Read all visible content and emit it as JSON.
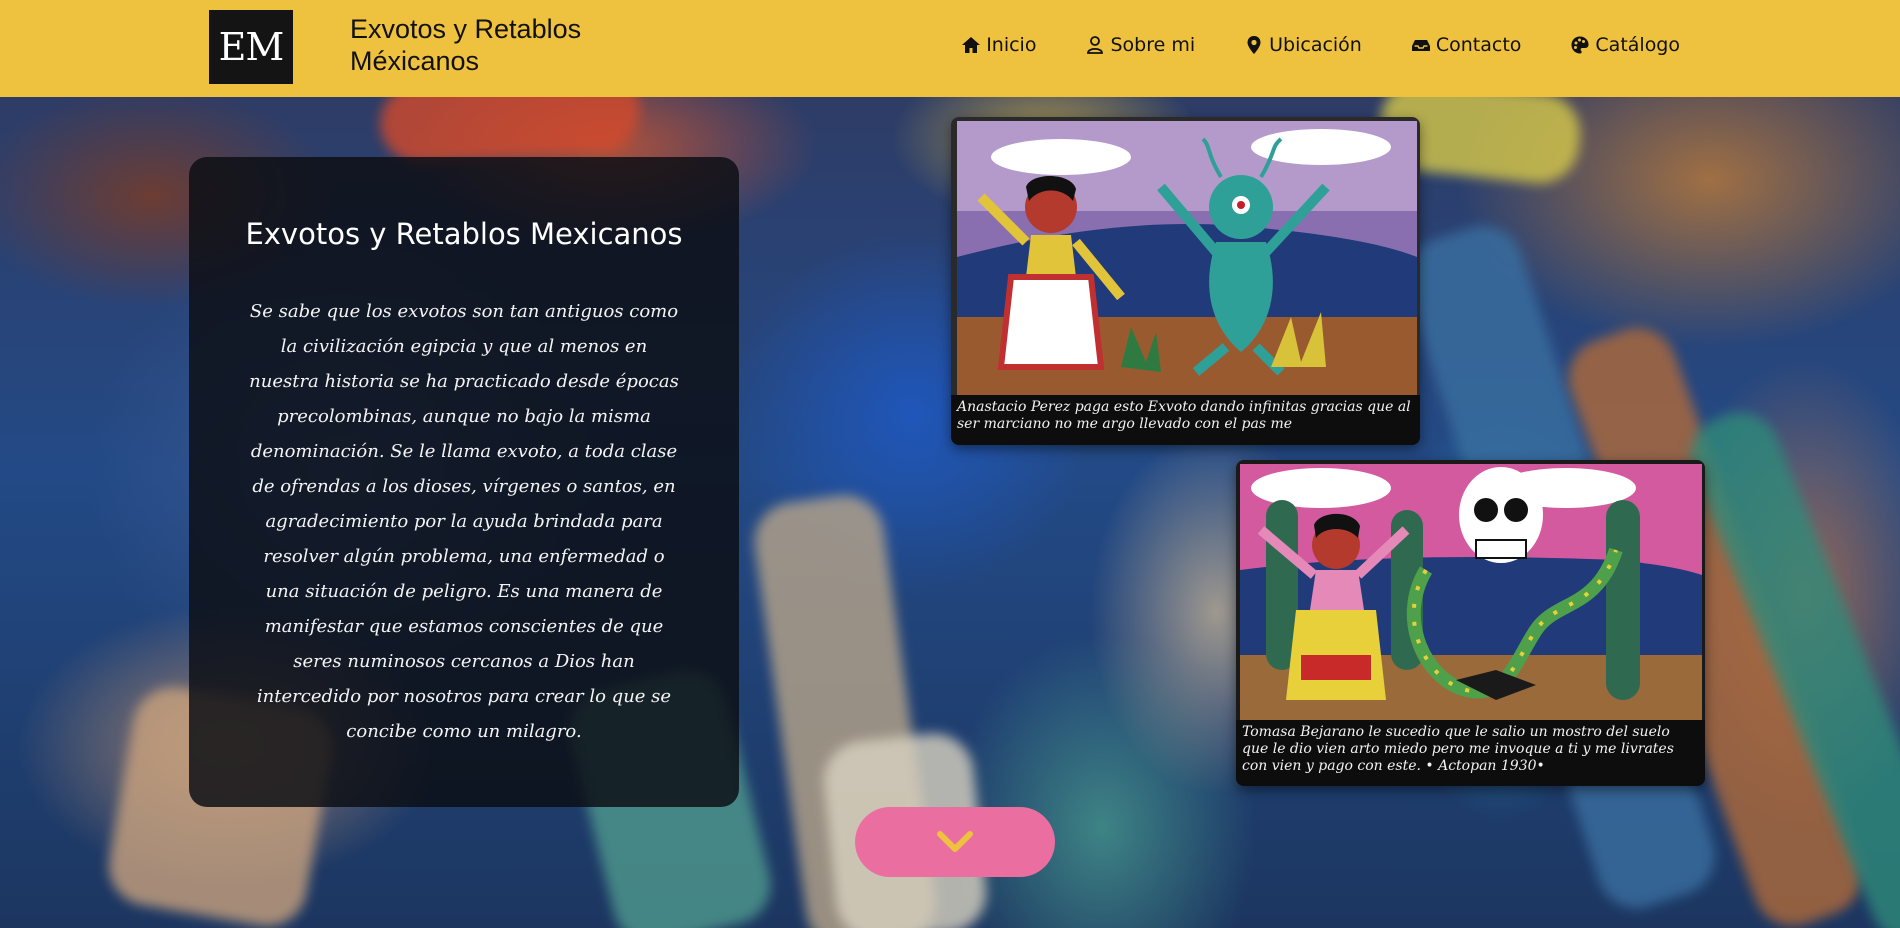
{
  "header": {
    "logo_text": "EM",
    "brand_line1": "Exvotos y Retablos",
    "brand_line2": "Méxicanos",
    "nav": [
      {
        "label": "Inicio",
        "icon": "home-icon"
      },
      {
        "label": "Sobre mi",
        "icon": "user-icon"
      },
      {
        "label": "Ubicación",
        "icon": "map-pin-icon"
      },
      {
        "label": "Contacto",
        "icon": "inbox-icon"
      },
      {
        "label": "Catálogo",
        "icon": "palette-icon"
      }
    ]
  },
  "card": {
    "title": "Exvotos y Retablos Mexicanos",
    "body": "Se sabe que los exvotos son tan antiguos como la civilización egipcia y que al menos en nuestra historia se ha practicado desde épocas precolombinas, aunque no bajo la misma denominación. Se le llama exvoto, a toda clase de ofrendas a los dioses, vírgenes o santos, en agradecimiento por la ayuda brindada para resolver algún problema, una enfermedad o una situación de peligro. Es una manera de manifestar que estamos conscientes de que seres numinosos cercanos a Dios han intercedido por nosotros para crear lo que se concibe como un milagro."
  },
  "paintings": [
    {
      "caption": "Anastacio Perez paga esto Exvoto dando infinitas gracias que al ser marciano no me argo llevado con el pas me"
    },
    {
      "caption": "Tomasa Bejarano le sucedio que le salio un mostro del suelo que le dio vien arto miedo pero me invoque a ti y me livrates con vien y pago con este. • Actopan 1930•"
    }
  ],
  "colors": {
    "header_bg": "#eec13f",
    "scroll_button": "#ea6fa0",
    "chevron": "#eec13f"
  },
  "scroll_button_icon": "chevron-down-icon"
}
